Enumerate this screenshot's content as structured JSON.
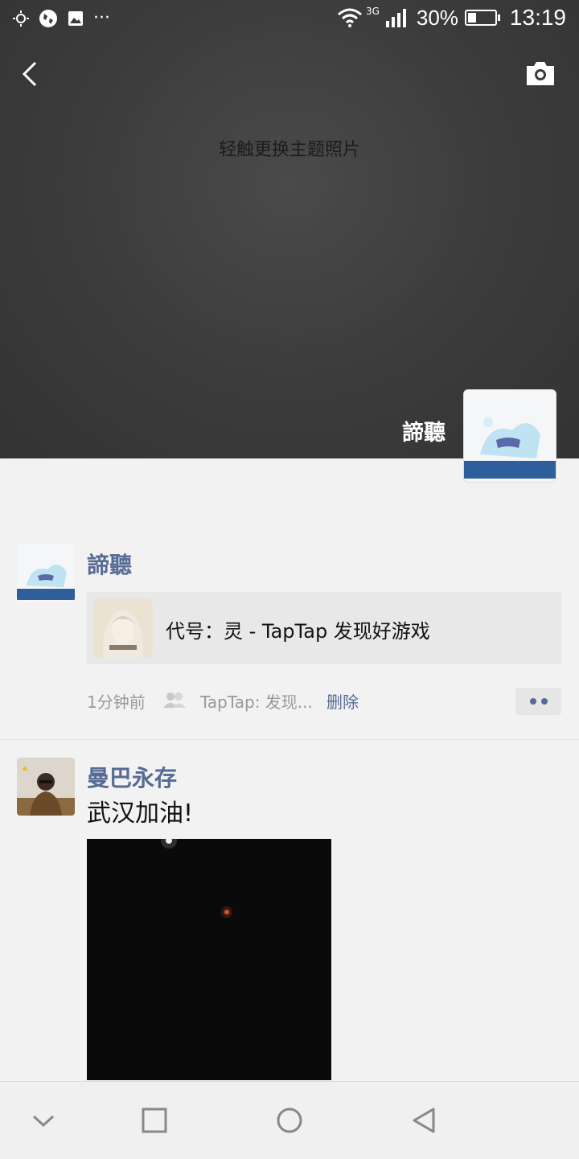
{
  "status_bar": {
    "battery": "30%",
    "battery_level": 0.3,
    "network": "3G",
    "time": "13:19"
  },
  "cover": {
    "hint": "轻触更换主题照片",
    "user_name": "諦聽"
  },
  "posts": [
    {
      "user": "諦聽",
      "share": {
        "title": "代号：灵 - TapTap 发现好游戏"
      },
      "time": "1分钟前",
      "source": "TapTap: 发现...",
      "delete_label": "删除"
    },
    {
      "user": "曼巴永存",
      "text": "武汉加油!"
    }
  ],
  "colors": {
    "link": "#576b95",
    "cover": "#3b3b3b"
  }
}
